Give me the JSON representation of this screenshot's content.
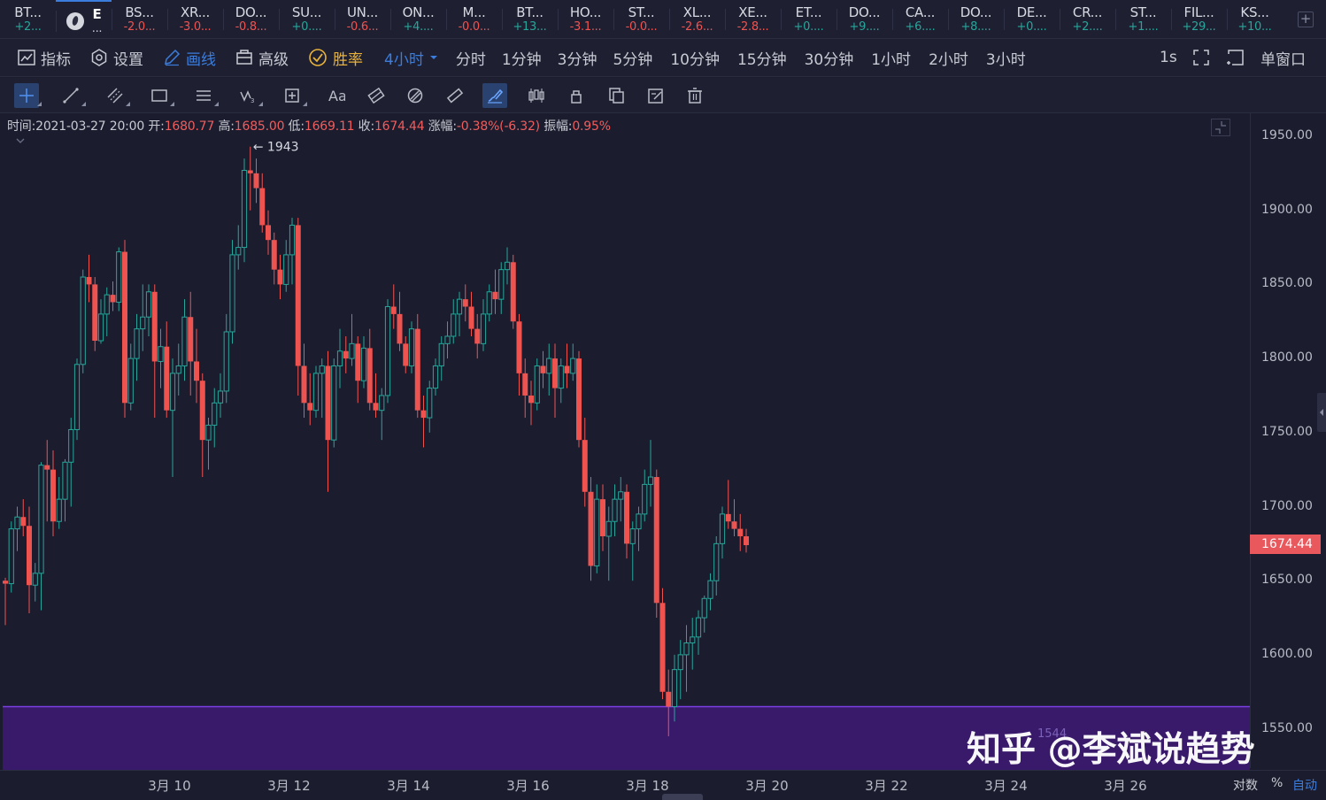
{
  "tickers": [
    {
      "sym": "BT...",
      "chg": "+2...",
      "dir": "up"
    },
    {
      "sym": "E",
      "chg": "...",
      "dir": "neutral",
      "active": true
    },
    {
      "sym": "BS...",
      "chg": "-2.0...",
      "dir": "down"
    },
    {
      "sym": "XR...",
      "chg": "-3.0...",
      "dir": "down"
    },
    {
      "sym": "DO...",
      "chg": "-0.8...",
      "dir": "down"
    },
    {
      "sym": "SU...",
      "chg": "+0....",
      "dir": "up"
    },
    {
      "sym": "UN...",
      "chg": "-0.6...",
      "dir": "down"
    },
    {
      "sym": "ON...",
      "chg": "+4....",
      "dir": "up"
    },
    {
      "sym": "M...",
      "chg": "-0.0...",
      "dir": "down"
    },
    {
      "sym": "BT...",
      "chg": "+13...",
      "dir": "up"
    },
    {
      "sym": "HO...",
      "chg": "-3.1...",
      "dir": "down"
    },
    {
      "sym": "ST...",
      "chg": "-0.0...",
      "dir": "down"
    },
    {
      "sym": "XL...",
      "chg": "-2.6...",
      "dir": "down"
    },
    {
      "sym": "XE...",
      "chg": "-2.8...",
      "dir": "down"
    },
    {
      "sym": "ET...",
      "chg": "+0....",
      "dir": "up"
    },
    {
      "sym": "DO...",
      "chg": "+9....",
      "dir": "up"
    },
    {
      "sym": "CA...",
      "chg": "+6....",
      "dir": "up"
    },
    {
      "sym": "DO...",
      "chg": "+8....",
      "dir": "up"
    },
    {
      "sym": "DE...",
      "chg": "+0....",
      "dir": "up"
    },
    {
      "sym": "CR...",
      "chg": "+2....",
      "dir": "up"
    },
    {
      "sym": "ST...",
      "chg": "+1....",
      "dir": "up"
    },
    {
      "sym": "FIL...",
      "chg": "+29...",
      "dir": "up"
    },
    {
      "sym": "KS...",
      "chg": "+10...",
      "dir": "up"
    }
  ],
  "add_tab": "+",
  "toolbar": {
    "indicators": "指标",
    "settings": "设置",
    "draw": "画线",
    "advanced": "高级",
    "winrate": "胜率",
    "current_interval": "4小时",
    "intervals": [
      "分时",
      "1分钟",
      "3分钟",
      "5分钟",
      "10分钟",
      "15分钟",
      "30分钟",
      "1小时",
      "2小时",
      "3小时"
    ],
    "refresh": "1s",
    "single_window": "单窗口"
  },
  "draw_tools": [
    "crosshair-icon",
    "trendline-icon",
    "parallel-channel-icon",
    "rectangle-icon",
    "horizontal-lines-icon",
    "wave-icon",
    "measure-icon",
    "text-icon",
    "pattern-icon",
    "eraser-icon",
    "ruler-icon",
    "brush-icon",
    "candles-icon",
    "lock-icon",
    "copy-icon",
    "edit-icon",
    "trash-icon"
  ],
  "ohlc": {
    "time_label": "时间:",
    "time": "2021-03-27 20:00",
    "open_label": "开:",
    "open": "1680.77",
    "high_label": "高:",
    "high": "1685.00",
    "low_label": "低:",
    "low": "1669.11",
    "close_label": "收:",
    "close": "1674.44",
    "change_label": "涨幅:",
    "change": "-0.38%(-6.32)",
    "amp_label": "振幅:",
    "amp": "0.95%"
  },
  "peak_label": "← 1943",
  "zone_label": "1544",
  "watermark": "知乎 @李斌说趋势",
  "last_price": "1674.44",
  "axis_options": {
    "log": "对数",
    "percent": "%",
    "auto": "自动"
  },
  "colors": {
    "up": "#26a69a",
    "down": "#ef5350",
    "accent": "#3b7ddd",
    "zone": "#3b1a6e",
    "zone_line": "#7b3fe4",
    "winrate": "#e8b23a"
  },
  "chart_data": {
    "type": "candlestick",
    "ylim": [
      1540,
      1970
    ],
    "yticks": [
      "1950.00",
      "1900.00",
      "1850.00",
      "1800.00",
      "1750.00",
      "1700.00",
      "1650.00",
      "1600.00",
      "1550.00"
    ],
    "ytick_values": [
      1950,
      1900,
      1850,
      1800,
      1750,
      1700,
      1650,
      1600,
      1550
    ],
    "xticks": [
      "3月 10",
      "3月 12",
      "3月 14",
      "3月 16",
      "3月 18",
      "3月 20",
      "3月 22",
      "3月 24",
      "3月 26"
    ],
    "xtick_candle_index": [
      27,
      47,
      67,
      87,
      107,
      127,
      147,
      167,
      187
    ],
    "zone": {
      "from": 1544,
      "to": 1565
    },
    "candles": [
      [
        1650,
        1652,
        1620,
        1648
      ],
      [
        1648,
        1690,
        1642,
        1685
      ],
      [
        1685,
        1700,
        1670,
        1693
      ],
      [
        1693,
        1705,
        1680,
        1687
      ],
      [
        1687,
        1700,
        1628,
        1647
      ],
      [
        1647,
        1662,
        1636,
        1655
      ],
      [
        1655,
        1730,
        1630,
        1728
      ],
      [
        1728,
        1745,
        1690,
        1725
      ],
      [
        1725,
        1738,
        1680,
        1690
      ],
      [
        1690,
        1720,
        1685,
        1705
      ],
      [
        1705,
        1732,
        1690,
        1730
      ],
      [
        1730,
        1760,
        1700,
        1752
      ],
      [
        1752,
        1800,
        1745,
        1796
      ],
      [
        1796,
        1860,
        1790,
        1855
      ],
      [
        1855,
        1870,
        1838,
        1850
      ],
      [
        1850,
        1855,
        1805,
        1812
      ],
      [
        1812,
        1840,
        1810,
        1830
      ],
      [
        1830,
        1848,
        1815,
        1843
      ],
      [
        1843,
        1852,
        1832,
        1838
      ],
      [
        1838,
        1875,
        1832,
        1872
      ],
      [
        1872,
        1880,
        1760,
        1770
      ],
      [
        1770,
        1810,
        1765,
        1800
      ],
      [
        1800,
        1830,
        1785,
        1820
      ],
      [
        1820,
        1850,
        1805,
        1828
      ],
      [
        1828,
        1850,
        1815,
        1845
      ],
      [
        1845,
        1850,
        1760,
        1798
      ],
      [
        1798,
        1820,
        1780,
        1808
      ],
      [
        1808,
        1825,
        1760,
        1765
      ],
      [
        1765,
        1800,
        1720,
        1790
      ],
      [
        1790,
        1810,
        1775,
        1795
      ],
      [
        1795,
        1840,
        1785,
        1828
      ],
      [
        1828,
        1845,
        1775,
        1798
      ],
      [
        1798,
        1820,
        1770,
        1785
      ],
      [
        1785,
        1790,
        1720,
        1745
      ],
      [
        1745,
        1760,
        1725,
        1755
      ],
      [
        1755,
        1780,
        1740,
        1770
      ],
      [
        1770,
        1790,
        1760,
        1778
      ],
      [
        1778,
        1830,
        1770,
        1818
      ],
      [
        1818,
        1880,
        1810,
        1870
      ],
      [
        1870,
        1890,
        1860,
        1875
      ],
      [
        1875,
        1935,
        1865,
        1927
      ],
      [
        1927,
        1943,
        1900,
        1925
      ],
      [
        1925,
        1935,
        1905,
        1915
      ],
      [
        1915,
        1925,
        1885,
        1890
      ],
      [
        1890,
        1900,
        1870,
        1880
      ],
      [
        1880,
        1885,
        1850,
        1860
      ],
      [
        1860,
        1870,
        1840,
        1850
      ],
      [
        1850,
        1880,
        1845,
        1870
      ],
      [
        1870,
        1895,
        1850,
        1890
      ],
      [
        1890,
        1895,
        1775,
        1795
      ],
      [
        1795,
        1810,
        1760,
        1770
      ],
      [
        1770,
        1790,
        1755,
        1765
      ],
      [
        1765,
        1795,
        1760,
        1790
      ],
      [
        1790,
        1800,
        1760,
        1795
      ],
      [
        1795,
        1805,
        1710,
        1745
      ],
      [
        1745,
        1800,
        1740,
        1795
      ],
      [
        1795,
        1820,
        1780,
        1805
      ],
      [
        1805,
        1815,
        1790,
        1800
      ],
      [
        1800,
        1830,
        1795,
        1810
      ],
      [
        1810,
        1815,
        1770,
        1785
      ],
      [
        1785,
        1815,
        1780,
        1807
      ],
      [
        1807,
        1820,
        1765,
        1770
      ],
      [
        1770,
        1790,
        1760,
        1765
      ],
      [
        1765,
        1780,
        1745,
        1775
      ],
      [
        1775,
        1840,
        1770,
        1835
      ],
      [
        1835,
        1850,
        1820,
        1830
      ],
      [
        1830,
        1845,
        1805,
        1810
      ],
      [
        1810,
        1815,
        1790,
        1795
      ],
      [
        1795,
        1825,
        1790,
        1820
      ],
      [
        1820,
        1830,
        1760,
        1765
      ],
      [
        1765,
        1775,
        1740,
        1760
      ],
      [
        1760,
        1785,
        1750,
        1780
      ],
      [
        1780,
        1800,
        1775,
        1795
      ],
      [
        1795,
        1815,
        1785,
        1810
      ],
      [
        1810,
        1825,
        1800,
        1815
      ],
      [
        1815,
        1840,
        1810,
        1830
      ],
      [
        1830,
        1845,
        1815,
        1840
      ],
      [
        1840,
        1850,
        1825,
        1835
      ],
      [
        1835,
        1845,
        1815,
        1820
      ],
      [
        1820,
        1830,
        1800,
        1810
      ],
      [
        1810,
        1840,
        1805,
        1830
      ],
      [
        1830,
        1850,
        1825,
        1845
      ],
      [
        1845,
        1860,
        1830,
        1840
      ],
      [
        1840,
        1865,
        1830,
        1860
      ],
      [
        1860,
        1875,
        1850,
        1865
      ],
      [
        1865,
        1870,
        1820,
        1825
      ],
      [
        1825,
        1830,
        1775,
        1790
      ],
      [
        1790,
        1800,
        1760,
        1775
      ],
      [
        1775,
        1785,
        1755,
        1770
      ],
      [
        1770,
        1800,
        1765,
        1795
      ],
      [
        1795,
        1805,
        1780,
        1790
      ],
      [
        1790,
        1810,
        1775,
        1800
      ],
      [
        1800,
        1810,
        1760,
        1780
      ],
      [
        1780,
        1800,
        1770,
        1795
      ],
      [
        1795,
        1810,
        1780,
        1790
      ],
      [
        1790,
        1810,
        1785,
        1800
      ],
      [
        1800,
        1805,
        1740,
        1745
      ],
      [
        1745,
        1760,
        1700,
        1710
      ],
      [
        1710,
        1720,
        1650,
        1660
      ],
      [
        1660,
        1715,
        1655,
        1705
      ],
      [
        1705,
        1715,
        1670,
        1680
      ],
      [
        1680,
        1700,
        1650,
        1690
      ],
      [
        1690,
        1715,
        1680,
        1705
      ],
      [
        1705,
        1720,
        1690,
        1710
      ],
      [
        1710,
        1715,
        1665,
        1675
      ],
      [
        1675,
        1690,
        1650,
        1685
      ],
      [
        1685,
        1700,
        1670,
        1695
      ],
      [
        1695,
        1725,
        1690,
        1715
      ],
      [
        1715,
        1745,
        1700,
        1720
      ],
      [
        1720,
        1725,
        1625,
        1635
      ],
      [
        1635,
        1645,
        1570,
        1575
      ],
      [
        1575,
        1590,
        1545,
        1565
      ],
      [
        1565,
        1600,
        1555,
        1590
      ],
      [
        1590,
        1610,
        1570,
        1600
      ],
      [
        1600,
        1620,
        1575,
        1608
      ],
      [
        1608,
        1625,
        1590,
        1612
      ],
      [
        1612,
        1630,
        1600,
        1625
      ],
      [
        1625,
        1640,
        1615,
        1638
      ],
      [
        1638,
        1655,
        1630,
        1650
      ],
      [
        1650,
        1680,
        1640,
        1675
      ],
      [
        1675,
        1700,
        1665,
        1695
      ],
      [
        1695,
        1718,
        1685,
        1690
      ],
      [
        1690,
        1705,
        1680,
        1685
      ],
      [
        1685,
        1695,
        1670,
        1680
      ],
      [
        1680,
        1685,
        1669,
        1674
      ]
    ]
  }
}
